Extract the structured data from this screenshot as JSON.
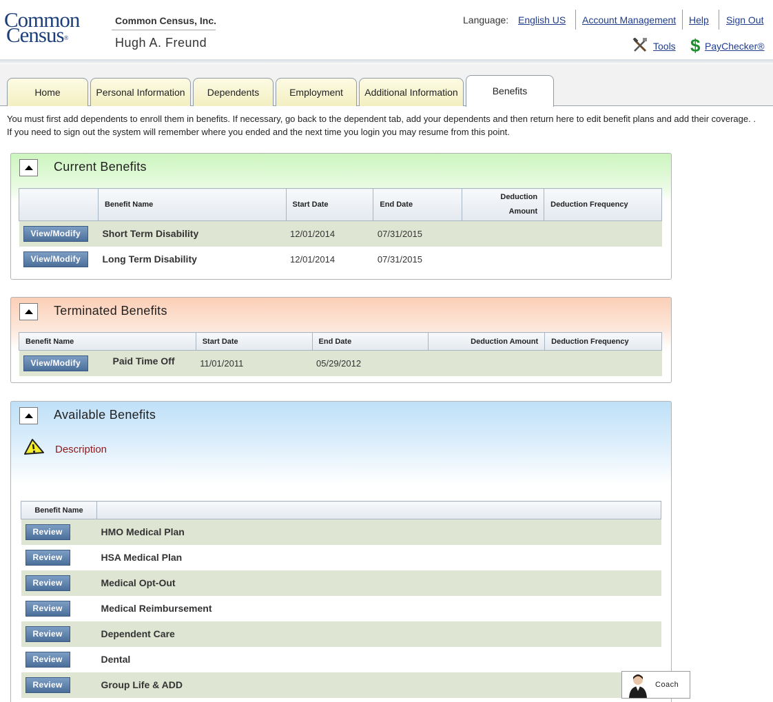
{
  "header": {
    "logo_line1": "Common",
    "logo_line2": "Census",
    "logo_mark": "®",
    "company": "Common Census, Inc.",
    "user_name": "Hugh A. Freund",
    "language_label": "Language:",
    "language_value": "English US",
    "account_management": "Account Management",
    "help": "Help",
    "sign_out": "Sign Out",
    "tools": "Tools",
    "paychecker": "PayChecker®",
    "tools_icon": "tools-icon",
    "paychecker_icon": "dollar-icon"
  },
  "tabs": [
    {
      "label": "Home"
    },
    {
      "label": "Personal Information"
    },
    {
      "label": "Dependents"
    },
    {
      "label": "Employment"
    },
    {
      "label": "Additional Information"
    },
    {
      "label": "Benefits",
      "active": true
    }
  ],
  "intro": {
    "line1": "You must first add dependents to enroll them in benefits. If necessary, go back to the dependent tab, add your dependents and then return here to edit benefit plans and add their coverage. .",
    "line2": "If you need to sign out the system will remember where you ended and the next time you login you may resume from this point."
  },
  "current": {
    "title": "Current Benefits",
    "headers": {
      "name": "Benefit Name",
      "start": "Start Date",
      "end": "End Date",
      "amount_line1": "Deduction",
      "amount_line2": "Amount",
      "frequency": "Deduction Frequency"
    },
    "rows": [
      {
        "button": "View/Modify",
        "name": "Short Term Disability",
        "start": "12/01/2014",
        "end": "07/31/2015",
        "amount": "",
        "frequency": ""
      },
      {
        "button": "View/Modify",
        "name": "Long Term Disability",
        "start": "12/01/2014",
        "end": "07/31/2015",
        "amount": "",
        "frequency": ""
      }
    ]
  },
  "terminated": {
    "title": "Terminated Benefits",
    "headers": {
      "name": "Benefit Name",
      "start": "Start Date",
      "end": "End Date",
      "amount": "Deduction Amount",
      "frequency": "Deduction Frequency"
    },
    "rows": [
      {
        "button": "View/Modify",
        "name": "Paid Time Off",
        "start": "11/01/2011",
        "end": "05/29/2012",
        "amount": "",
        "frequency": ""
      }
    ]
  },
  "available": {
    "title": "Available Benefits",
    "description_link": "Description",
    "warning_icon": "warning-icon",
    "header_name": "Benefit Name",
    "review_label": "Review",
    "items": [
      "HMO Medical Plan",
      "HSA Medical Plan",
      "Medical Opt-Out",
      "Medical Reimbursement",
      "Dependent Care",
      "Dental",
      "Group Life & ADD"
    ]
  },
  "coach": {
    "label": "Coach"
  },
  "colors": {
    "link": "#1f3c8c",
    "button": "#4b6f9a",
    "current_panel": "#ccf5be",
    "terminated_panel": "#fbcfb7",
    "available_panel": "#bfe0f8",
    "row_shade": "#dee5d3",
    "description_link": "#8b1a1a"
  }
}
